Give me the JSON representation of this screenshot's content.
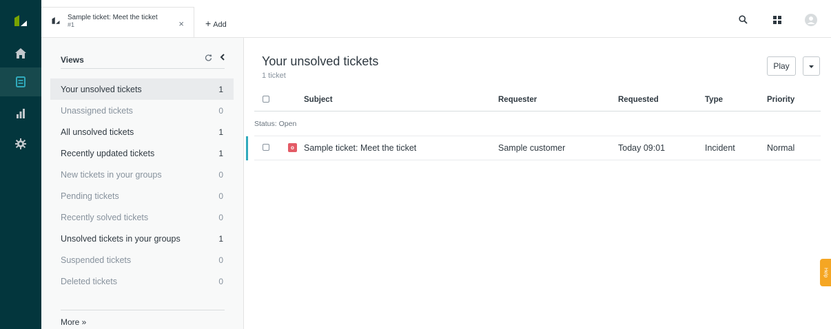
{
  "tab": {
    "title": "Sample ticket: Meet the ticket",
    "subtitle": "#1",
    "close": "×"
  },
  "topbar": {
    "add_label": "Add",
    "add_plus": "+"
  },
  "views": {
    "title": "Views",
    "items": [
      {
        "label": "Your unsolved tickets",
        "count": "1"
      },
      {
        "label": "Unassigned tickets",
        "count": "0"
      },
      {
        "label": "All unsolved tickets",
        "count": "1"
      },
      {
        "label": "Recently updated tickets",
        "count": "1"
      },
      {
        "label": "New tickets in your groups",
        "count": "0"
      },
      {
        "label": "Pending tickets",
        "count": "0"
      },
      {
        "label": "Recently solved tickets",
        "count": "0"
      },
      {
        "label": "Unsolved tickets in your groups",
        "count": "1"
      },
      {
        "label": "Suspended tickets",
        "count": "0"
      },
      {
        "label": "Deleted tickets",
        "count": "0"
      }
    ],
    "more": "More »"
  },
  "main": {
    "title": "Your unsolved tickets",
    "subtitle": "1 ticket",
    "play_label": "Play",
    "columns": {
      "subject": "Subject",
      "requester": "Requester",
      "requested": "Requested",
      "type": "Type",
      "priority": "Priority"
    },
    "group_label": "Status: Open",
    "rows": [
      {
        "status_letter": "o",
        "subject": "Sample ticket: Meet the ticket",
        "requester": "Sample customer",
        "requested": "Today 09:01",
        "type": "Incident",
        "priority": "Normal"
      }
    ]
  },
  "help_tab": "Help",
  "colors": {
    "nav_bg": "#03363d",
    "accent": "#30aabc",
    "status_open": "#e35b66",
    "help": "#f5a623",
    "logo": "#78a300"
  }
}
